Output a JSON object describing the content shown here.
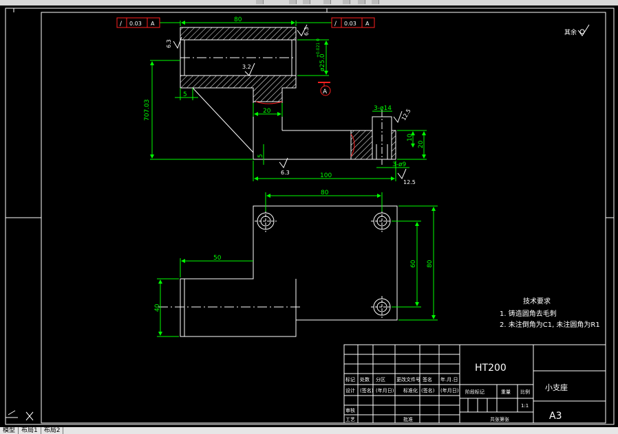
{
  "colors": {
    "line": "#ffffff",
    "dim": "#00ff00",
    "red": "#ff2020",
    "frame": "#ffffff",
    "background": "#000000"
  },
  "tolerance": {
    "left": {
      "symbol": "/",
      "value": "0.03",
      "datum": "A"
    },
    "right": {
      "symbol": "/",
      "value": "0.03",
      "datum": "A"
    }
  },
  "datum_label": "A",
  "roughness_other": "其余",
  "front_view": {
    "dim_top": "80",
    "dim_bore": "ø25.0",
    "dim_bore_tol": "+0.021 0",
    "dim_height": "707.03",
    "dim_step": "20",
    "dim_five_h": "5",
    "dim_five_v": "5",
    "dim_hole": "3-ø14",
    "dim_hole_small": "3-ø9",
    "dim_ten": "10",
    "dim_twenty": "20",
    "dim_total": "100",
    "rough_left": "6.3",
    "rough_top": "6.3",
    "rough_inner": "3.2",
    "rough_bottom": "6.3",
    "rough_hole": "12.5",
    "rough_hole_bottom": "12.5"
  },
  "top_view": {
    "dim_top": "80",
    "dim_left": "50",
    "dim_sixty": "60",
    "dim_eighty": "80",
    "dim_forty": "40"
  },
  "notes": {
    "title": "技术要求",
    "line1": "1. 铸造圆角去毛刺",
    "line2": "2. 未注倒角为C1, 未注圆角为R1"
  },
  "title_block": {
    "material": "HT200",
    "part_name": "小支座",
    "sheet_size": "A3",
    "scale": "1:1",
    "h_mark": "标记",
    "h_count": "处数",
    "h_zone": "分区",
    "h_docno": "更改文件号",
    "h_sign": "签名",
    "h_date": "年.月.日",
    "h_design": "设计",
    "h_signed": "(签名)",
    "h_dated": "(年月日)",
    "h_std": "标准化",
    "h_signed2": "(签名)",
    "h_dated2": "(年月日)",
    "h_stage": "阶段标记",
    "h_weight": "重量",
    "h_scale": "比例",
    "h_review": "审核",
    "h_process": "工艺",
    "h_approve": "批准",
    "h_sheets": "共张第张"
  },
  "tabs": {
    "model": "模型",
    "layout1": "布局1",
    "layout2": "布局2"
  }
}
